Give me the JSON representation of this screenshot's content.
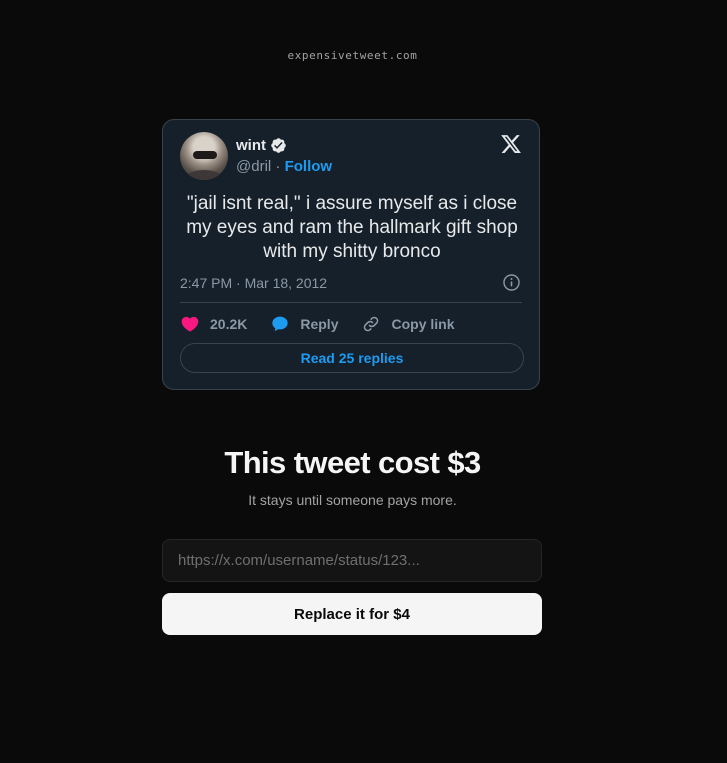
{
  "site": {
    "name": "expensivetweet.com"
  },
  "tweet": {
    "author": {
      "name": "wint",
      "handle": "@dril",
      "separator": " · ",
      "follow_label": "Follow",
      "verified_icon": "verified-badge-icon"
    },
    "brand_icon": "x-logo-icon",
    "text": "\"jail isnt real,\" i assure myself as i close\nmy eyes and ram the hallmark gift shop\nwith my shitty bronco",
    "timestamp": "2:47 PM · Mar 18, 2012",
    "info_icon": "info-icon",
    "actions": {
      "likes": "20.2K",
      "reply_label": "Reply",
      "copy_link_label": "Copy link"
    },
    "read_replies_label": "Read 25 replies"
  },
  "pricing": {
    "heading": "This tweet cost $3",
    "subheading": "It stays until someone pays more."
  },
  "form": {
    "url_placeholder": "https://x.com/username/status/123...",
    "url_value": "",
    "submit_label": "Replace it for $4"
  },
  "colors": {
    "background": "#0a0a0a",
    "card_background": "#15202b",
    "card_border": "#38444d",
    "link_blue": "#1d9bf0",
    "like_pink": "#f91880",
    "button_background": "#f5f5f5"
  }
}
